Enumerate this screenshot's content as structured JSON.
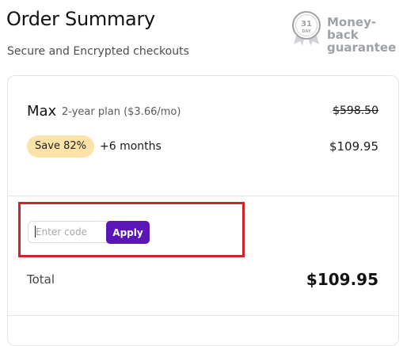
{
  "header": {
    "title": "Order Summary",
    "subtitle": "Secure and Encrypted checkouts"
  },
  "guarantee": {
    "days": "31",
    "unit": "DAY",
    "line1": "Money-back",
    "line2": "guarantee",
    "icon": "badge-seal-icon"
  },
  "plan": {
    "name": "Max",
    "description": "2-year plan ($3.66/mo)",
    "original_price": "$598.50",
    "discount_label": "Save 82%",
    "extra_label": "+6 months",
    "price": "$109.95"
  },
  "coupon": {
    "placeholder": "Enter code",
    "value": "",
    "apply_label": "Apply"
  },
  "summary": {
    "total_label": "Total",
    "total_value": "$109.95"
  },
  "colors": {
    "accent": "#5a16b6",
    "discount_pill": "#fde3a7",
    "highlight": "#d0232a",
    "badge_gray": "#9ea1a6"
  }
}
